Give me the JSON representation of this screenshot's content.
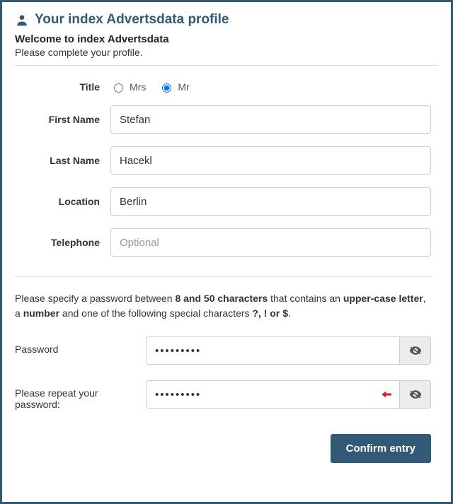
{
  "header": {
    "title": "Your index Advertsdata profile"
  },
  "intro": {
    "welcome": "Welcome to index Advertsdata",
    "subtitle": "Please complete your profile."
  },
  "form": {
    "title": {
      "label": "Title",
      "options": {
        "mrs": "Mrs",
        "mr": "Mr"
      },
      "selected": "mr"
    },
    "first_name": {
      "label": "First Name",
      "value": "Stefan"
    },
    "last_name": {
      "label": "Last Name",
      "value": "Hacekl"
    },
    "location": {
      "label": "Location",
      "value": "Berlin"
    },
    "telephone": {
      "label": "Telephone",
      "value": "",
      "placeholder": "Optional"
    }
  },
  "password_hint": {
    "pre": "Please specify a password between ",
    "chars": "8 and 50 characters",
    "mid1": " that contains an ",
    "upper": "upper-case letter",
    "mid2": ", a ",
    "number": "number",
    "mid3": " and one of the following special characters ",
    "specials": "?, ! or $",
    "post": "."
  },
  "password": {
    "label": "Password",
    "value": "•••••••••",
    "repeat_label": "Please repeat your password:",
    "repeat_value": "•••••••••"
  },
  "actions": {
    "confirm": "Confirm entry"
  }
}
